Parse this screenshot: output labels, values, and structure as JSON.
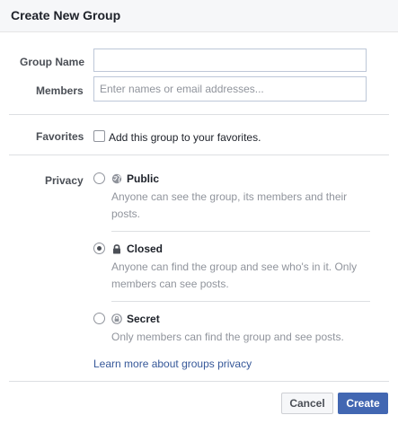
{
  "dialog": {
    "title": "Create New Group"
  },
  "form": {
    "group_name_label": "Group Name",
    "group_name_value": "",
    "members_label": "Members",
    "members_placeholder": "Enter names or email addresses...",
    "members_value": "",
    "favorites_label": "Favorites",
    "favorites_checkbox_label": "Add this group to your favorites.",
    "favorites_checked": false,
    "privacy_label": "Privacy"
  },
  "privacy": {
    "options": [
      {
        "id": "public",
        "icon": "globe-icon",
        "title": "Public",
        "description": "Anyone can see the group, its members and their posts.",
        "selected": false
      },
      {
        "id": "closed",
        "icon": "lock-icon",
        "title": "Closed",
        "description": "Anyone can find the group and see who's in it. Only members can see posts.",
        "selected": true
      },
      {
        "id": "secret",
        "icon": "secret-lock-icon",
        "title": "Secret",
        "description": "Only members can find the group and see posts.",
        "selected": false
      }
    ],
    "learn_more_link": "Learn more about groups privacy"
  },
  "footer": {
    "cancel_label": "Cancel",
    "create_label": "Create"
  },
  "colors": {
    "accent": "#4267b2",
    "link": "#365899",
    "muted_text": "#90949c",
    "header_bg": "#f6f7f9"
  }
}
